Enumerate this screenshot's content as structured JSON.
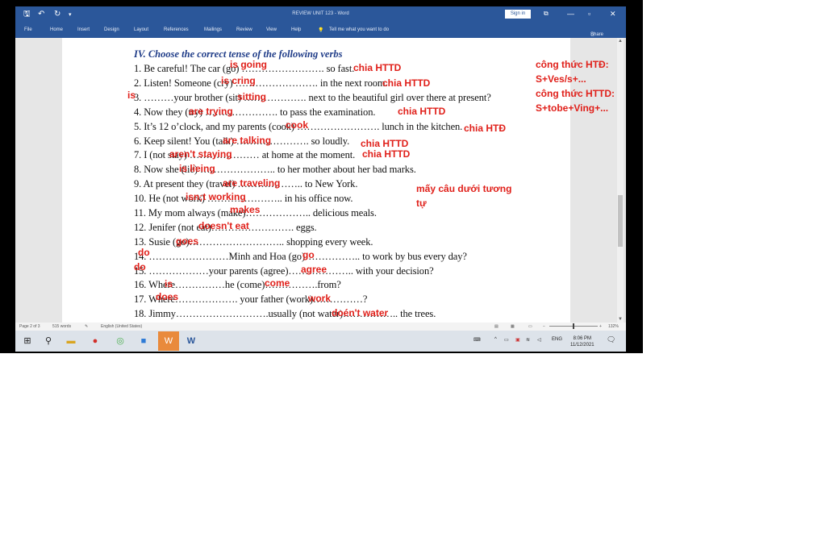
{
  "window": {
    "title": "REVIEW UNIT 123 - Word",
    "sign_in": "Sign in",
    "minimize": "—",
    "maximize": "▫",
    "close": "✕"
  },
  "ribbon_tabs": [
    "File",
    "Home",
    "Insert",
    "Design",
    "Layout",
    "References",
    "Mailings",
    "Review",
    "View",
    "Help",
    "Tell me what you want to do",
    "Share"
  ],
  "document": {
    "heading": "IV. Choose the correct tense of the following verbs",
    "lines": [
      "1. Be careful! The car (go) ……………………. so fast.",
      "2. Listen! Someone (cry) ……………………. in the next room.",
      "3. ………your brother (sit) ………………. next to the beautiful girl over there at present?",
      "4. Now they (try) …………………. to pass the examination.",
      "5. It’s 12 o’clock, and my parents (cook) ……………………. lunch in the kitchen.",
      "6. Keep silent! You (talk) …………………. so loudly.",
      "7. I (not stay) ………………… at home at the moment.",
      "8. Now she (lie) ………………….. to her mother about her bad marks.",
      "9. At present they (travel) ……………….. to New York.",
      "10. He (not work) ………………….. in his office now.",
      "11. My mom always (make)……………….. delicious meals.",
      "12. Jenifer (not eat)……………………. eggs.",
      "13. Susie (go)……………………….. shopping every week.",
      "14. ……………………Minh and Hoa (go)…………….. to work by bus every day?",
      "15. ………………your parents (agree)……………….. with your decision?",
      "16. Where……………he (come)…………….from?",
      "17. Where………………. your father (work)……………?",
      "18. Jimmy……………………….usually (not water)…………….. the trees."
    ]
  },
  "answers": [
    "is going",
    "is cring",
    "is",
    "sitting",
    "are trying",
    "cook",
    "are talking",
    "aren't staying",
    "is lieing",
    "are traveling",
    "isn;t working",
    "makes",
    "doesn't eat",
    "goes",
    "do",
    "go",
    "do",
    "agree",
    "is",
    "come",
    "does",
    "work",
    "doén't water"
  ],
  "margin_notes": [
    "chia HTTD",
    "chia HTTD",
    "chia HTTD",
    "chia HTĐ",
    "chia HTTD",
    "chia HTTD",
    "mấy câu dưới tương",
    "tự"
  ],
  "side_notes": [
    "công thức HTĐ:",
    "S+Ves/s+...",
    "công thức HTTD:",
    "S+tobe+Ving+..."
  ],
  "status_bar": {
    "page": "Page 2 of 3",
    "words": "515 words",
    "language": "English (United States)",
    "zoom": "132%"
  },
  "taskbar": {
    "language": "ENG",
    "time": "8:06 PM",
    "date": "11/12/2021"
  },
  "colors": {
    "word_blue": "#2b579a",
    "annotation_red": "#e0201a",
    "heading_blue": "#1f3c88"
  }
}
